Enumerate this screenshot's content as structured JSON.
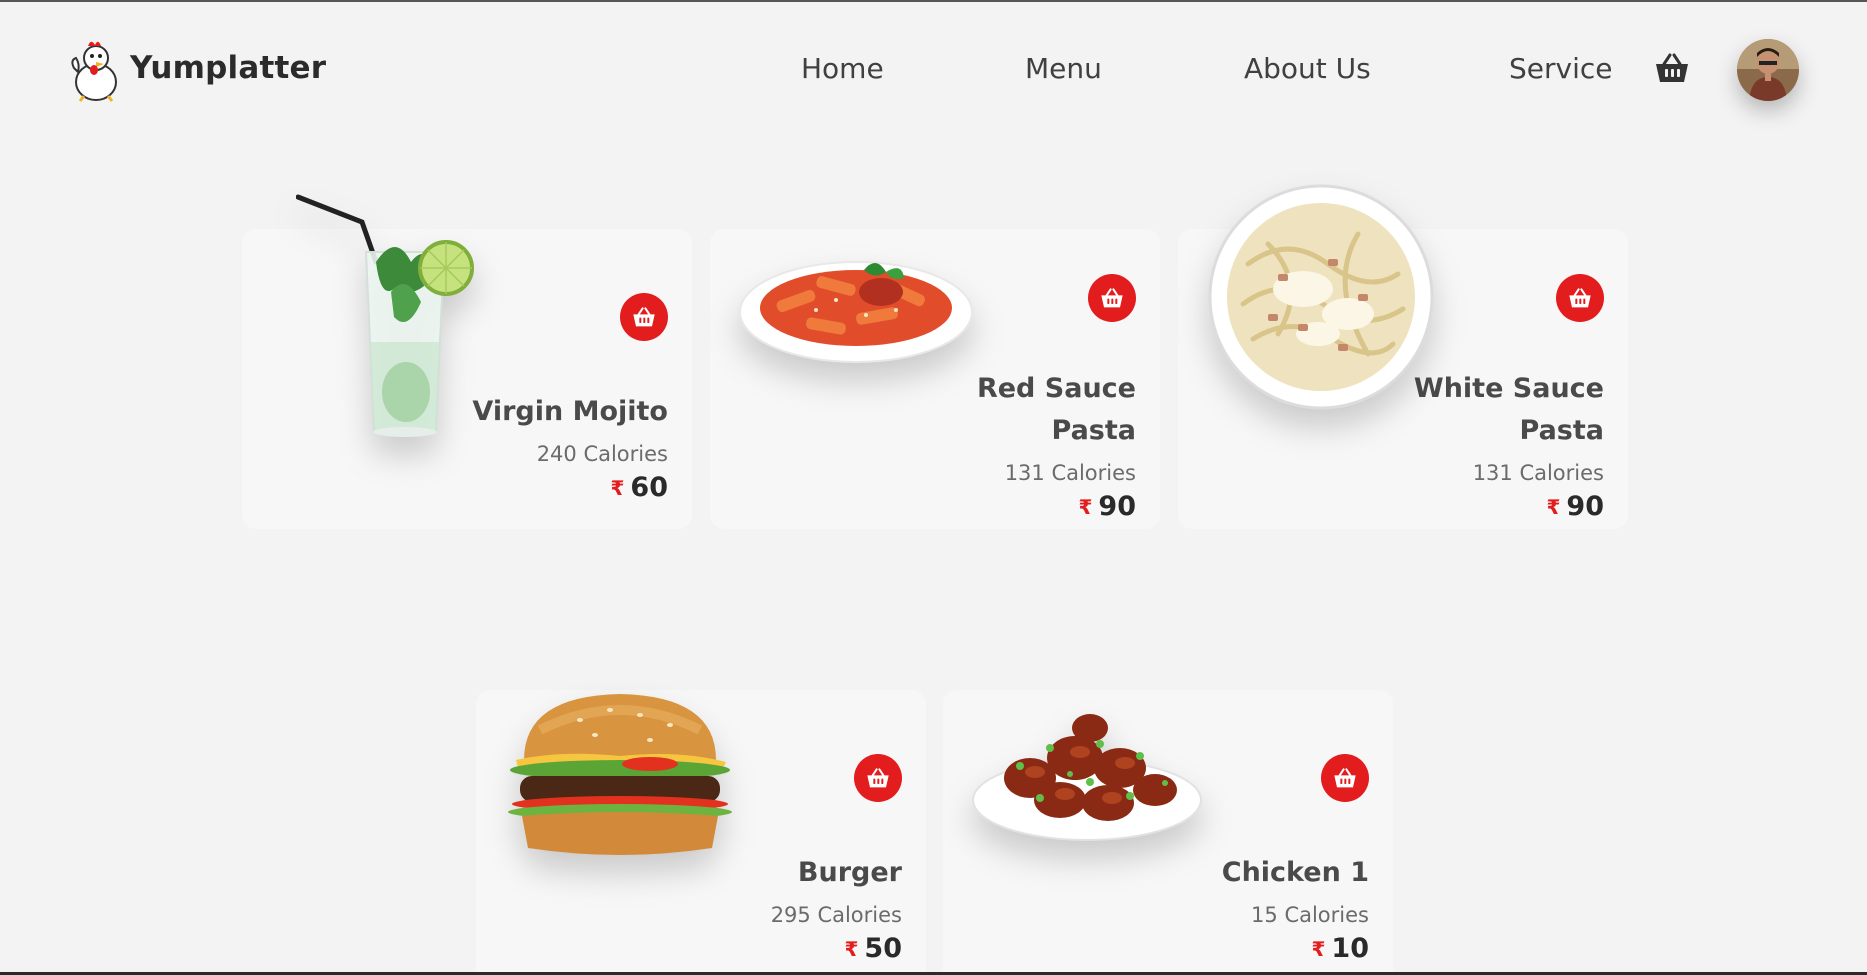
{
  "header": {
    "brand": "Yumplatter",
    "nav": [
      "Home",
      "Menu",
      "About Us",
      "Service"
    ]
  },
  "colors": {
    "accent": "#e31d1d",
    "background": "#f4f3f3",
    "card": "#f7f7f7"
  },
  "currency_symbol": "₹",
  "items": [
    {
      "name": "Virgin Mojito",
      "calories": "240 Calories",
      "price": "60"
    },
    {
      "name_line1": "Red Sauce",
      "name_line2": "Pasta",
      "calories": "131 Calories",
      "price": "90"
    },
    {
      "name_line1": "White Sauce",
      "name_line2": "Pasta",
      "calories": "131 Calories",
      "price": "90"
    },
    {
      "name": "Burger",
      "calories": "295 Calories",
      "price": "50"
    },
    {
      "name": "Chicken 1",
      "calories": "15 Calories",
      "price": "10"
    }
  ]
}
